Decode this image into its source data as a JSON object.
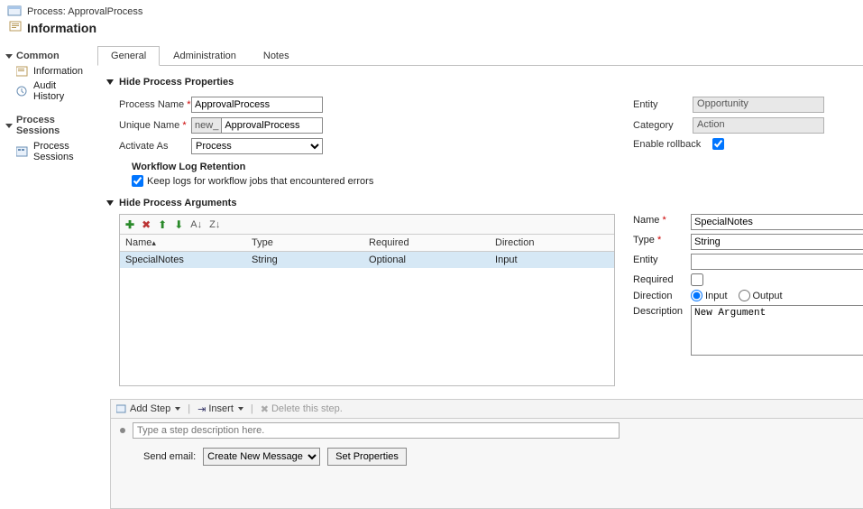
{
  "header": {
    "process_label": "Process: ApprovalProcess",
    "page_title": "Information"
  },
  "sidebar": {
    "groups": [
      {
        "title": "Common",
        "items": [
          {
            "icon": "info-icon",
            "label": "Information"
          },
          {
            "icon": "audit-icon",
            "label": "Audit History"
          }
        ]
      },
      {
        "title": "Process Sessions",
        "items": [
          {
            "icon": "sessions-icon",
            "label": "Process Sessions"
          }
        ]
      }
    ]
  },
  "tabs": [
    "General",
    "Administration",
    "Notes"
  ],
  "active_tab": 0,
  "sections": {
    "properties_title": "Hide Process Properties",
    "arguments_title": "Hide Process Arguments"
  },
  "form": {
    "process_name": {
      "label": "Process Name",
      "value": "ApprovalProcess"
    },
    "unique_name": {
      "label": "Unique Name",
      "prefix": "new_",
      "value": "ApprovalProcess"
    },
    "activate_as": {
      "label": "Activate As",
      "value": "Process"
    },
    "entity": {
      "label": "Entity",
      "value": "Opportunity"
    },
    "category": {
      "label": "Category",
      "value": "Action"
    },
    "rollback": {
      "label": "Enable rollback",
      "checked": true
    }
  },
  "workflow_log": {
    "title": "Workflow Log Retention",
    "option": "Keep logs for workflow jobs that encountered errors",
    "checked": true
  },
  "arguments": {
    "columns": {
      "name": "Name",
      "type": "Type",
      "required": "Required",
      "direction": "Direction"
    },
    "name_sort_indicator": "▴",
    "rows": [
      {
        "name": "SpecialNotes",
        "type": "String",
        "required": "Optional",
        "direction": "Input"
      }
    ],
    "toolbar_icons": [
      "add-icon",
      "delete-icon",
      "move-up-icon",
      "move-down-icon",
      "sort-asc-icon",
      "sort-desc-icon"
    ],
    "detail": {
      "name_label": "Name",
      "name_value": "SpecialNotes",
      "type_label": "Type",
      "type_value": "String",
      "entity_label": "Entity",
      "entity_value": "",
      "required_label": "Required",
      "required_checked": false,
      "direction_label": "Direction",
      "direction_input": "Input",
      "direction_output": "Output",
      "direction_value": "Input",
      "description_label": "Description",
      "description_value": "New Argument"
    }
  },
  "steps": {
    "toolbar": {
      "add_step": "Add Step",
      "insert": "Insert",
      "delete": "Delete this step."
    },
    "placeholder": "Type a step description here.",
    "action": {
      "label": "Send email:",
      "select_value": "Create New Message",
      "button": "Set Properties"
    }
  }
}
